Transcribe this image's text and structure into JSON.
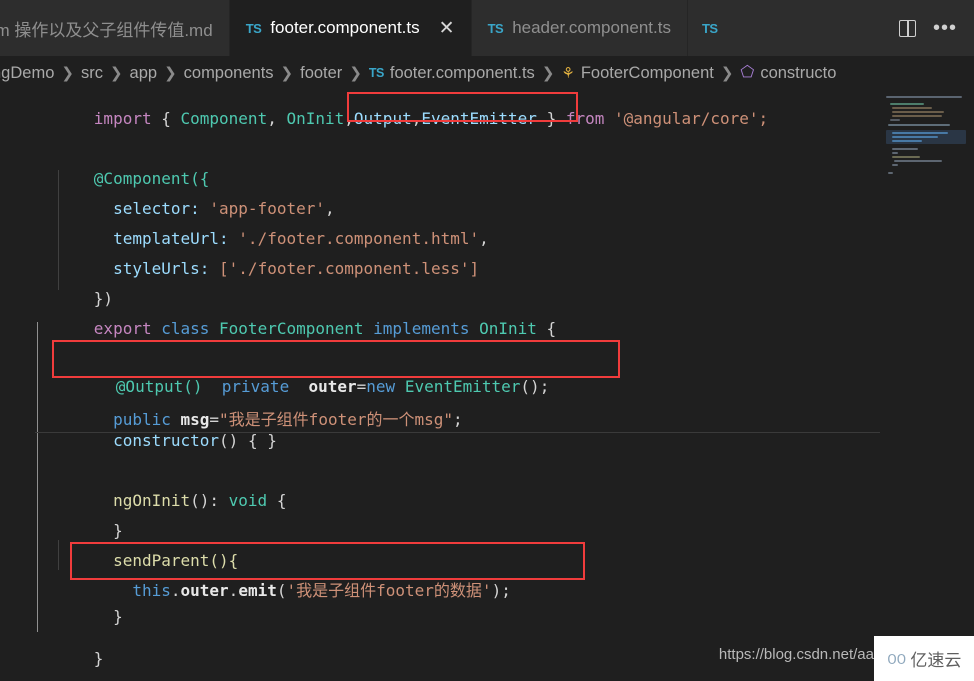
{
  "window": {
    "background": "#1f1f1f",
    "tabbar_background": "#2d2d2d",
    "accent_red": "#f03c3c"
  },
  "tabs": [
    {
      "label": "om 操作以及父子组件传值.md",
      "icon": "",
      "active": false,
      "closable": false
    },
    {
      "label": "footer.component.ts",
      "icon": "TS",
      "active": true,
      "closable": true,
      "close_glyph": "✕"
    },
    {
      "label": "header.component.ts",
      "icon": "TS",
      "active": false,
      "closable": false
    },
    {
      "label": "",
      "icon": "TS",
      "active": false,
      "closable": false
    }
  ],
  "tabbar_actions": [
    {
      "name": "split-editor",
      "glyph": ""
    },
    {
      "name": "more-actions",
      "glyph": "•••"
    }
  ],
  "breadcrumb": {
    "separator": "❯",
    "items": [
      {
        "label": "ngDemo",
        "icon": ""
      },
      {
        "label": "src",
        "icon": ""
      },
      {
        "label": "app",
        "icon": ""
      },
      {
        "label": "components",
        "icon": ""
      },
      {
        "label": "footer",
        "icon": ""
      },
      {
        "label": "footer.component.ts",
        "icon": "TS"
      },
      {
        "label": "FooterComponent",
        "icon": "interface"
      },
      {
        "label": "constructo",
        "icon": "cube"
      }
    ]
  },
  "code": {
    "line1": {
      "import_kw": "import",
      "brace_open": " { ",
      "component": "Component",
      "comma1": ", ",
      "oninit": "OnInit",
      "comma2": ",",
      "output": "Output",
      "comma3": ",",
      "eventemitter": "EventEmitter",
      "brace_close": " } ",
      "from_kw": "from",
      "module": " '@angular/core';"
    },
    "line_component_dec": "@Component({",
    "line_selector_key": "  selector: ",
    "line_selector_val": "'app-footer'",
    "line_selector_end": ",",
    "line_template_key": "  templateUrl: ",
    "line_template_val": "'./footer.component.html'",
    "line_template_end": ",",
    "line_styles_key": "  styleUrls: ",
    "line_styles_val": "['./footer.component.less']",
    "line_dec_close": "})",
    "line_export_kw": "export",
    "line_class_kw": " class ",
    "line_class_name": "FooterComponent",
    "line_implements_kw": " implements ",
    "line_interface": "OnInit",
    "line_class_open": " {",
    "line_output_dec": "@Output()",
    "line_output_private": "  private",
    "line_output_name": "  outer",
    "line_output_eq": "=",
    "line_output_new": "new",
    "line_output_emitter": " EventEmitter",
    "line_output_end": "();",
    "line_msg_public": "  public ",
    "line_msg_name": "msg",
    "line_msg_eq": "=",
    "line_msg_val": "\"我是子组件footer的一个msg\"",
    "line_msg_end": ";",
    "line_ctor_name": "  constructor",
    "line_ctor_parens": "() ",
    "line_ctor_open": "{",
    "line_ctor_space": " ",
    "line_ctor_close": "}",
    "line_ngoninit_name": "  ngOnInit",
    "line_ngoninit_parens": "(): ",
    "line_ngoninit_void": "void",
    "line_ngoninit_open": " {",
    "line_ngoninit_close": "  }",
    "line_sendparent": "  sendParent(){",
    "line_emit_this": "    this",
    "line_emit_dot1": ".",
    "line_emit_outer": "outer",
    "line_emit_dot2": ".",
    "line_emit_method": "emit",
    "line_emit_open": "(",
    "line_emit_arg": "'我是子组件footer的数据'",
    "line_emit_end": ");",
    "line_sendparent_close": "  }",
    "line_class_close": "}"
  },
  "annotations": [
    {
      "name": "output-eventemitter-import-highlight",
      "color": "#f03c3c"
    },
    {
      "name": "output-declaration-highlight",
      "color": "#f03c3c"
    },
    {
      "name": "emit-call-highlight",
      "color": "#f03c3c"
    }
  ],
  "watermark": {
    "url": "https://blog.csdn.net/aa",
    "logo_mark": "൦൦",
    "logo_text": "亿速云"
  }
}
